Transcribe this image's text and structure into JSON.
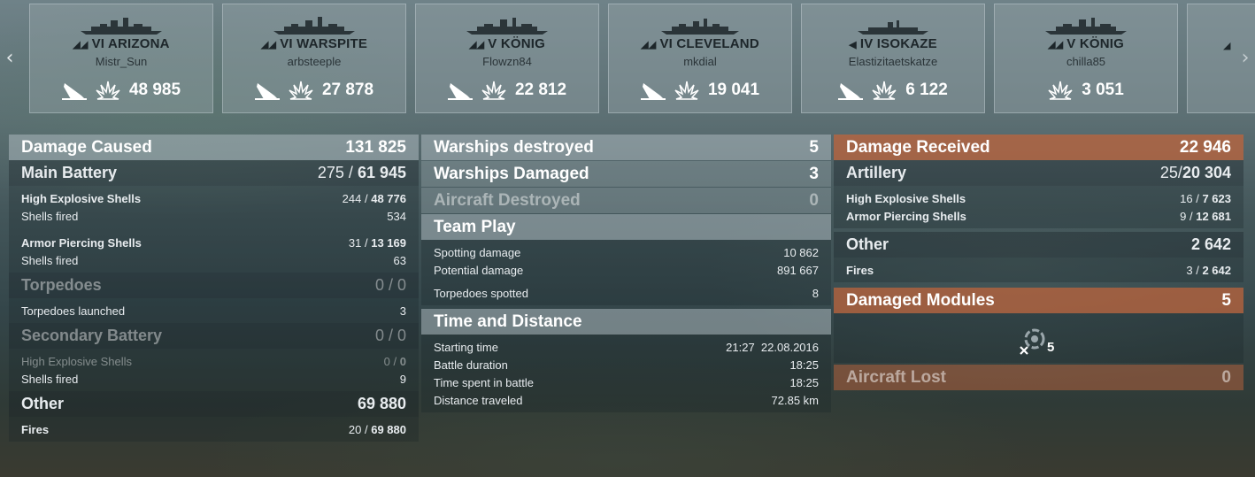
{
  "ships": [
    {
      "tier_name": "VI ARIZONA",
      "player": "Mistr_Sun",
      "damage": "48 985",
      "class_icon": "battleship-icon",
      "has_kill": true
    },
    {
      "tier_name": "VI WARSPITE",
      "player": "arbsteeple",
      "damage": "27 878",
      "class_icon": "battleship-icon",
      "has_kill": true
    },
    {
      "tier_name": "V KÖNIG",
      "player": "Flowzn84",
      "damage": "22 812",
      "class_icon": "battleship-icon",
      "has_kill": true
    },
    {
      "tier_name": "VI CLEVELAND",
      "player": "mkdial",
      "damage": "19 041",
      "class_icon": "cruiser-icon",
      "has_kill": true
    },
    {
      "tier_name": "IV ISOKAZE",
      "player": "Elastizitaetskatze",
      "damage": "6 122",
      "class_icon": "destroyer-icon",
      "has_kill": true
    },
    {
      "tier_name": "V KÖNIG",
      "player": "chilla85",
      "damage": "3 051",
      "class_icon": "battleship-icon",
      "has_kill": false
    }
  ],
  "damage_caused": {
    "title": "Damage Caused",
    "value": "131 825",
    "main_battery": {
      "label": "Main Battery",
      "hits": "275",
      "sep": "/",
      "damage": "61 945"
    },
    "he_shells": {
      "label": "High Explosive Shells",
      "hits": "244",
      "sep": "/",
      "damage": "48 776"
    },
    "he_fired": {
      "label": "Shells fired",
      "value": "534"
    },
    "ap_shells": {
      "label": "Armor Piercing Shells",
      "hits": "31",
      "sep": "/",
      "damage": "13 169"
    },
    "ap_fired": {
      "label": "Shells fired",
      "value": "63"
    },
    "torpedoes": {
      "label": "Torpedoes",
      "value": "0 / 0"
    },
    "torp_launched": {
      "label": "Torpedoes launched",
      "value": "3"
    },
    "secondary": {
      "label": "Secondary Battery",
      "value": "0 / 0"
    },
    "sec_he": {
      "label": "High Explosive Shells",
      "hits": "0",
      "sep": "/",
      "damage": "0"
    },
    "sec_fired": {
      "label": "Shells fired",
      "value": "9"
    },
    "other": {
      "label": "Other",
      "value": "69 880"
    },
    "fires": {
      "label": "Fires",
      "hits": "20",
      "sep": "/",
      "damage": "69 880"
    }
  },
  "middle": {
    "destroyed": {
      "label": "Warships destroyed",
      "value": "5"
    },
    "damaged": {
      "label": "Warships Damaged",
      "value": "3"
    },
    "aircraft": {
      "label": "Aircraft Destroyed",
      "value": "0"
    },
    "team_play": {
      "title": "Team Play"
    },
    "spotting": {
      "label": "Spotting damage",
      "value": "10 862"
    },
    "potential": {
      "label": "Potential damage",
      "value": "891 667"
    },
    "torp_spotted": {
      "label": "Torpedoes spotted",
      "value": "8"
    },
    "time_distance": {
      "title": "Time and Distance"
    },
    "start": {
      "label": "Starting time",
      "value": "21:27  22.08.2016"
    },
    "duration": {
      "label": "Battle duration",
      "value": "18:25"
    },
    "time_spent": {
      "label": "Time spent in battle",
      "value": "18:25"
    },
    "distance": {
      "label": "Distance traveled",
      "value": "72.85 km"
    }
  },
  "received": {
    "title": "Damage Received",
    "value": "22 946",
    "artillery": {
      "label": "Artillery",
      "hits": "25",
      "sep": "/",
      "damage": "20 304"
    },
    "he": {
      "label": "High Explosive Shells",
      "hits": "16",
      "sep": "/",
      "damage": "7 623"
    },
    "ap": {
      "label": "Armor Piercing Shells",
      "hits": "9",
      "sep": "/",
      "damage": "12 681"
    },
    "other": {
      "label": "Other",
      "value": "2 642"
    },
    "fires": {
      "label": "Fires",
      "hits": "3",
      "sep": "/",
      "damage": "2 642"
    },
    "modules": {
      "label": "Damaged Modules",
      "value": "5",
      "icon_count": "5"
    },
    "aircraft_lost": {
      "label": "Aircraft Lost",
      "value": "0"
    }
  }
}
